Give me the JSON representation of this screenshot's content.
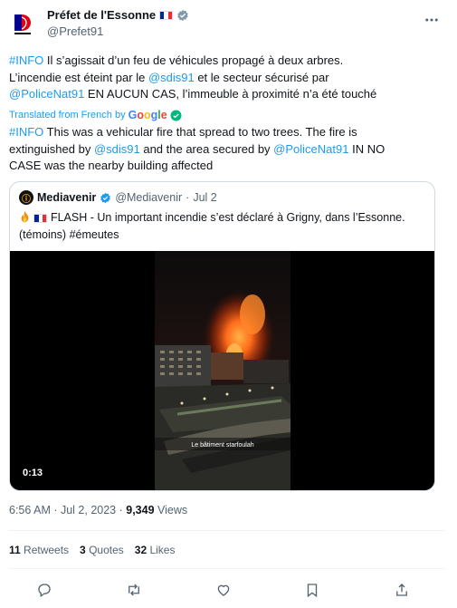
{
  "author": {
    "name": "Préfet de l'Essonne",
    "handle": "@Prefet91"
  },
  "tweet": {
    "original_lines": [
      [
        "#INFO",
        " Il s’agissait d’un feu de véhicules propagé à deux arbres."
      ],
      [
        "L’incendie est éteint par le ",
        "@sdis91",
        " et le secteur sécurisé par"
      ],
      [
        "@PoliceNat91",
        " EN AUCUN CAS, l’immeuble à proximité n’a été touché"
      ]
    ],
    "translated_label": "Translated from French by",
    "translated_by": "Google",
    "translation_lines": [
      [
        "#INFO",
        " This was a vehicular fire that spread to two trees. The fire is"
      ],
      [
        "extinguished by ",
        "@sdis91",
        " and the area secured by ",
        "@PoliceNat91",
        " IN NO"
      ],
      [
        "CASE was the nearby building affected"
      ]
    ]
  },
  "quote": {
    "name": "Mediavenir",
    "handle": "@Mediavenir",
    "date": "Jul 2",
    "line1": "FLASH - Un important incendie s’est déclaré à Grigny, dans l’Essonne.",
    "line2": "(témoins) #émeutes",
    "video_duration": "0:13",
    "video_caption": "Le bâtiment starfoulah"
  },
  "meta": {
    "time_date": "6:56 AM · Jul 2, 2023 · ",
    "views_count": "9,349",
    "views_label": " Views"
  },
  "stats": {
    "retweets_count": "11",
    "retweets_label": " Retweets",
    "quotes_count": "3",
    "quotes_label": " Quotes",
    "likes_count": "32",
    "likes_label": " Likes"
  },
  "colors": {
    "accent": "#1d9bf0",
    "secondary_text": "#536471",
    "verified": "#829aab",
    "fire": "#ff6a1a"
  }
}
